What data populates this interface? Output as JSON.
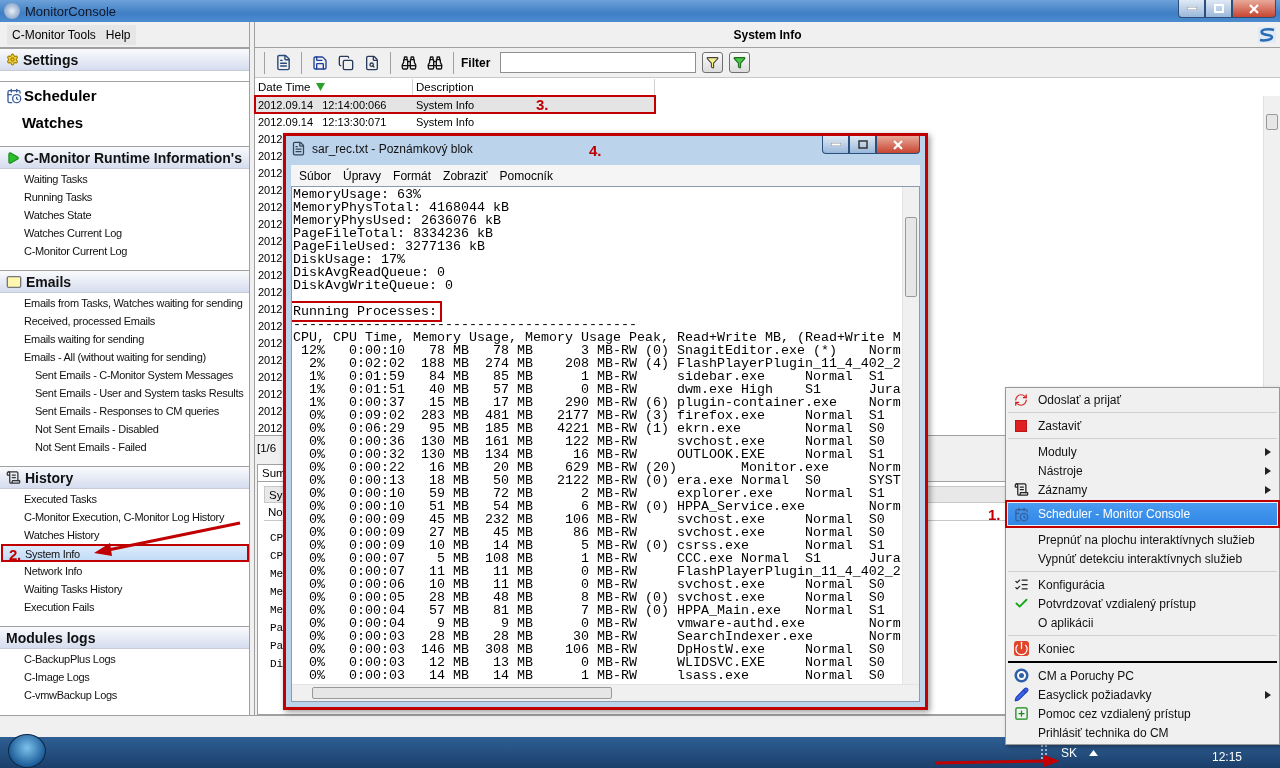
{
  "window": {
    "title": "MonitorConsole"
  },
  "menu": [
    "C-Monitor Tools",
    "Help"
  ],
  "sidebar": [
    {
      "title": "Settings",
      "kind": "header"
    },
    {
      "title": "Scheduler",
      "kind": "large",
      "items": [
        {
          "label": "Watches",
          "selected": false
        }
      ]
    },
    {
      "title": "C-Monitor Runtime Information's",
      "kind": "header",
      "items": [
        {
          "label": "Waiting Tasks",
          "selected": false
        },
        {
          "label": "Running Tasks",
          "selected": false
        },
        {
          "label": "Watches State",
          "selected": false
        },
        {
          "label": "Watches Current Log",
          "selected": false
        },
        {
          "label": "C-Monitor Current Log",
          "selected": false
        }
      ]
    },
    {
      "title": "Emails",
      "kind": "header",
      "items": [
        {
          "label": "Emails from Tasks, Watches waiting for sending",
          "selected": false
        },
        {
          "label": "Received, processed Emails",
          "selected": false
        },
        {
          "label": "Emails waiting for sending",
          "selected": false
        },
        {
          "label": "Emails - All (without waiting for sending)",
          "selected": false,
          "children": [
            {
              "label": "Sent Emails - C-Monitor System Messages",
              "selected": false
            },
            {
              "label": "Sent Emails - User and System tasks Results",
              "selected": false
            },
            {
              "label": "Sent Emails - Responses to CM queries",
              "selected": false
            },
            {
              "label": "Not Sent Emails - Disabled",
              "selected": false
            },
            {
              "label": "Not Sent Emails - Failed",
              "selected": false
            }
          ]
        }
      ]
    },
    {
      "title": "History",
      "kind": "header",
      "items": [
        {
          "label": "Executed Tasks",
          "selected": false
        },
        {
          "label": "C-Monitor Execution, C-Monitor Log History",
          "selected": false
        },
        {
          "label": "Watches History",
          "selected": false
        },
        {
          "label": "System Info",
          "selected": true,
          "annotation": "2."
        },
        {
          "label": "Network Info",
          "selected": false
        },
        {
          "label": "Waiting Tasks History",
          "selected": false
        },
        {
          "label": "Execution Fails",
          "selected": false
        }
      ]
    },
    {
      "title": "Modules logs",
      "kind": "header",
      "items": [
        {
          "label": "C-BackupPlus Logs",
          "selected": false
        },
        {
          "label": "C-Image Logs",
          "selected": false
        },
        {
          "label": "C-vmwBackup Logs",
          "selected": false
        }
      ]
    }
  ],
  "main": {
    "title": "System Info",
    "filter_label": "Filter",
    "table": {
      "columns": [
        {
          "label": "Date Time",
          "sorted": true
        },
        {
          "label": "Description",
          "sorted": false
        }
      ],
      "rows": [
        {
          "date_time": "2012.09.14   12:14:00:066",
          "description": "System Info",
          "selected": true,
          "annotation": "3."
        },
        {
          "date_time": "2012.09.14   12:13:30:071",
          "description": "System Info",
          "selected": false
        },
        {
          "date_time": "2012",
          "selected": false
        },
        {
          "date_time": "2012",
          "selected": false
        },
        {
          "date_time": "2012",
          "selected": false
        },
        {
          "date_time": "2012",
          "selected": false
        },
        {
          "date_time": "2012",
          "selected": false
        },
        {
          "date_time": "2012",
          "selected": false
        },
        {
          "date_time": "2012",
          "selected": false
        },
        {
          "date_time": "2012",
          "selected": false
        },
        {
          "date_time": "2012",
          "selected": false
        },
        {
          "date_time": "2012",
          "selected": false
        },
        {
          "date_time": "2012",
          "selected": false
        },
        {
          "date_time": "2012",
          "selected": false
        },
        {
          "date_time": "2012",
          "selected": false
        },
        {
          "date_time": "2012",
          "selected": false
        },
        {
          "date_time": "2012",
          "selected": false
        },
        {
          "date_time": "2012",
          "selected": false
        },
        {
          "date_time": "2012",
          "selected": false
        },
        {
          "date_time": "2012",
          "selected": false
        }
      ]
    },
    "lower_pane": {
      "pager": "[1/6",
      "tab": "Sum",
      "header": "Sy",
      "first_row": "No",
      "lines": [
        "CP",
        "CP",
        "Me",
        "Me",
        "Me",
        "Pa",
        "Pa",
        "Di"
      ]
    }
  },
  "notepad": {
    "title": "sar_rec.txt - Poznámkový blok",
    "annotation": "4.",
    "menu": [
      "Súbor",
      "Úpravy",
      "Formát",
      "Zobraziť",
      "Pomocník"
    ],
    "stats": [
      "MemoryUsage: 63%",
      "MemoryPhysTotal: 4168044 kB",
      "MemoryPhysUsed: 2636076 kB",
      "PageFileTotal: 8334236 kB",
      "PageFileUsed: 3277136 kB",
      "DiskUsage: 17%",
      "DiskAvgReadQueue: 0",
      "DiskAvgWriteQueue: 0"
    ],
    "heading": {
      "text": "Running Processes:",
      "boxed": true
    },
    "rule": "-------------------------------------------",
    "lines": [
      "CPU, CPU Time, Memory Usage, Memory Usage Peak, Read+Write MB, (Read+Write M",
      " 12%   0:00:10   78 MB   78 MB      3 MB-RW (0) SnagitEditor.exe (*)    Norm",
      "  2%   0:02:02  188 MB  274 MB    208 MB-RW (4) FlashPlayerPlugin_11_4_402_2",
      "  1%   0:01:59   84 MB   85 MB      1 MB-RW     sidebar.exe     Normal  S1",
      "  1%   0:01:51   40 MB   57 MB      0 MB-RW     dwm.exe High    S1      Jura",
      "  1%   0:00:37   15 MB   17 MB    290 MB-RW (6) plugin-container.exe    Norm",
      "  0%   0:09:02  283 MB  481 MB   2177 MB-RW (3) firefox.exe     Normal  S1",
      "  0%   0:06:29   95 MB  185 MB   4221 MB-RW (1) ekrn.exe        Normal  S0",
      "  0%   0:00:36  130 MB  161 MB    122 MB-RW     svchost.exe     Normal  S0",
      "  0%   0:00:32  130 MB  134 MB     16 MB-RW     OUTLOOK.EXE     Normal  S1",
      "  0%   0:00:22   16 MB   20 MB    629 MB-RW (20)        Monitor.exe     Norm",
      "  0%   0:00:13   18 MB   50 MB   2122 MB-RW (0) era.exe Normal  S0      SYST",
      "  0%   0:00:10   59 MB   72 MB      2 MB-RW     explorer.exe    Normal  S1",
      "  0%   0:00:10   51 MB   54 MB      6 MB-RW (0) HPPA_Service.exe        Norm",
      "  0%   0:00:09   45 MB  232 MB    106 MB-RW     svchost.exe     Normal  S0",
      "  0%   0:00:09   27 MB   45 MB     86 MB-RW     svchost.exe     Normal  S0",
      "  0%   0:00:09   10 MB   14 MB      5 MB-RW (0) csrss.exe       Normal  S1",
      "  0%   0:00:07    5 MB  108 MB      1 MB-RW     CCC.exe Normal  S1      Jura",
      "  0%   0:00:07   11 MB   11 MB      0 MB-RW     FlashPlayerPlugin_11_4_402_2",
      "  0%   0:00:06   10 MB   11 MB      0 MB-RW     svchost.exe     Normal  S0",
      "  0%   0:00:05   28 MB   48 MB      8 MB-RW (0) svchost.exe     Normal  S0",
      "  0%   0:00:04   57 MB   81 MB      7 MB-RW (0) HPPA_Main.exe   Normal  S1",
      "  0%   0:00:04    9 MB    9 MB      0 MB-RW     vmware-authd.exe        Norm",
      "  0%   0:00:03   28 MB   28 MB     30 MB-RW     SearchIndexer.exe       Norm",
      "  0%   0:00:03  146 MB  308 MB    106 MB-RW     DpHostW.exe     Normal  S0",
      "  0%   0:00:03   12 MB   13 MB      0 MB-RW     WLIDSVC.EXE     Normal  S0",
      "  0%   0:00:03   14 MB   14 MB      1 MB-RW     lsass.exe       Normal  S0"
    ]
  },
  "context_menu": [
    {
      "kind": "item",
      "label": "Odoslať a prijať"
    },
    {
      "kind": "separator"
    },
    {
      "kind": "item",
      "label": "Zastaviť"
    },
    {
      "kind": "separator"
    },
    {
      "kind": "item",
      "label": "Moduly",
      "submenu": true
    },
    {
      "kind": "item",
      "label": "Nástroje",
      "submenu": true
    },
    {
      "kind": "item",
      "label": "Záznamy",
      "submenu": true
    },
    {
      "kind": "item",
      "label": "Scheduler - Monitor Console",
      "selected": true,
      "annotation": "1."
    },
    {
      "kind": "item",
      "label": "Prepnúť na plochu interaktívnych služieb"
    },
    {
      "kind": "item",
      "label": "Vypnúť detekciu interaktívnych služieb"
    },
    {
      "kind": "separator"
    },
    {
      "kind": "item",
      "label": "Konfigurácia"
    },
    {
      "kind": "check",
      "label": "Potvrdzovať vzdialený prístup",
      "checked": true
    },
    {
      "kind": "item",
      "label": "O aplikácii"
    },
    {
      "kind": "separator"
    },
    {
      "kind": "item",
      "label": "Koniec"
    },
    {
      "kind": "thick_separator"
    },
    {
      "kind": "item",
      "label": "CM a Poruchy PC"
    },
    {
      "kind": "item",
      "label": "Easyclick požiadavky",
      "submenu": true
    },
    {
      "kind": "item",
      "label": "Pomoc cez vzdialený prístup"
    },
    {
      "kind": "item",
      "label": "Prihlásiť technika do CM"
    }
  ],
  "taskbar": {
    "language": "SK",
    "clock": "12:15"
  }
}
